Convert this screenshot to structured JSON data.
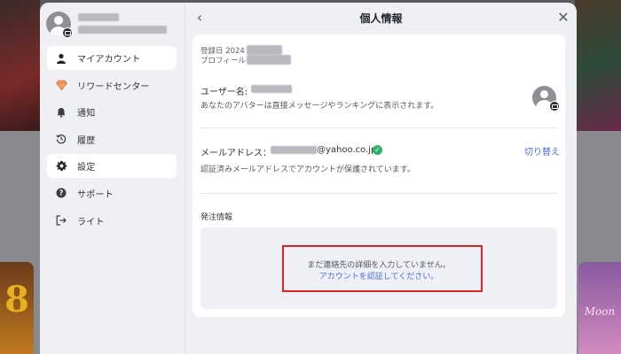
{
  "sidebar": {
    "items": [
      {
        "label": "マイアカウント",
        "icon": "person-icon",
        "active": true
      },
      {
        "label": "リワードセンター",
        "icon": "diamond-icon",
        "active": false
      },
      {
        "label": "通知",
        "icon": "bell-icon",
        "active": false
      },
      {
        "label": "履歴",
        "icon": "history-icon",
        "active": false
      },
      {
        "label": "設定",
        "icon": "gear-icon",
        "active": true
      },
      {
        "label": "サポート",
        "icon": "help-icon",
        "active": false
      },
      {
        "label": "ライト",
        "icon": "logout-icon",
        "active": false
      }
    ]
  },
  "header": {
    "title": "個人情報",
    "back_glyph": "‹",
    "close_glyph": "✕"
  },
  "account": {
    "registered_prefix": "登録日 2024",
    "profile_prefix": "プロフィール",
    "username_label": "ユーザー名:",
    "username_desc": "あなたのアバターは直接メッセージやランキングに表示されます。",
    "email_label": "メールアドレス：",
    "email_domain": "@yahoo.co.jp",
    "email_verified_glyph": "✓",
    "email_switch": "切り替え",
    "email_desc": "認証済みメールアドレスでアカウントが保護されています。"
  },
  "order": {
    "label": "発注情報",
    "notice_line1": "まだ連絡先の詳細を入力していません。",
    "notice_line2": "アカウントを認証してください。"
  },
  "background": {
    "left_number": "8",
    "right_text": "Moon"
  },
  "colors": {
    "accent": "#4a6de0",
    "verified": "#2fb264",
    "highlight": "#d82424"
  }
}
